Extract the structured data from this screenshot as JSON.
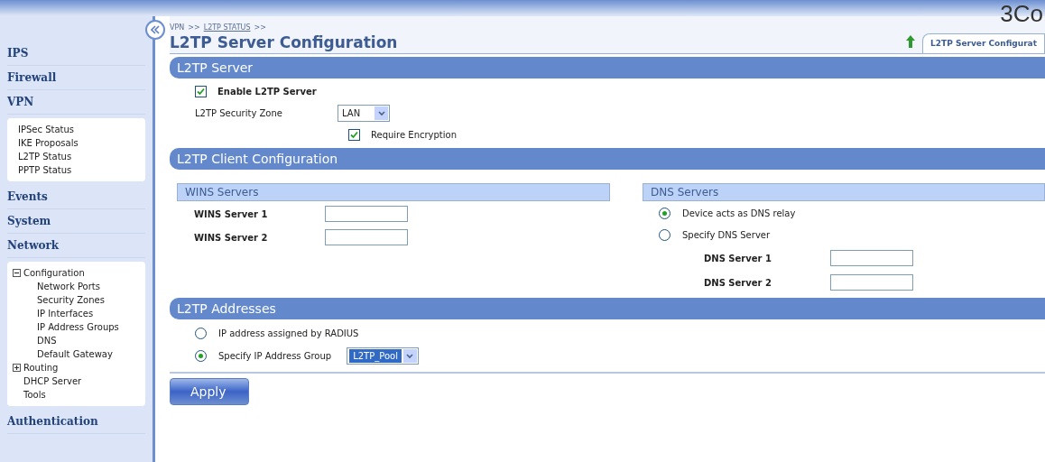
{
  "logo": "3Co",
  "sidebar": {
    "groups": [
      {
        "label": "IPS"
      },
      {
        "label": "Firewall"
      },
      {
        "label": "VPN",
        "items": [
          {
            "label": "IPSec Status"
          },
          {
            "label": "IKE Proposals"
          },
          {
            "label": "L2TP Status"
          },
          {
            "label": "PPTP Status"
          }
        ]
      },
      {
        "label": "Events"
      },
      {
        "label": "System"
      },
      {
        "label": "Network",
        "items": [
          {
            "label": "Configuration",
            "kind": "branch",
            "expanded": true,
            "children": [
              {
                "label": "Network Ports"
              },
              {
                "label": "Security Zones"
              },
              {
                "label": "IP Interfaces"
              },
              {
                "label": "IP Address Groups"
              },
              {
                "label": "DNS"
              },
              {
                "label": "Default Gateway"
              }
            ]
          },
          {
            "label": "Routing",
            "kind": "branch",
            "expanded": false
          },
          {
            "label": "DHCP Server"
          },
          {
            "label": "Tools"
          }
        ]
      },
      {
        "label": "Authentication"
      }
    ]
  },
  "breadcrumb": [
    {
      "label": "VPN",
      "link": false
    },
    {
      "label": ">>",
      "link": false
    },
    {
      "label": "L2TP STATUS",
      "link": true
    },
    {
      "label": ">>",
      "link": false
    }
  ],
  "title": "L2TP Server Configuration",
  "tab": {
    "label": "L2TP Server Configurat",
    "selected": true
  },
  "server": {
    "heading": "L2TP Server",
    "enable": {
      "label": "Enable L2TP Server",
      "checked": true
    },
    "zone": {
      "label": "L2TP Security Zone",
      "value": "LAN"
    },
    "encryption": {
      "label": "Require Encryption",
      "checked": true
    }
  },
  "client": {
    "heading": "L2TP Client Configuration",
    "wins": {
      "heading": "WINS Servers",
      "fields": [
        {
          "label": "WINS Server 1"
        },
        {
          "label": "WINS Server 2"
        }
      ]
    },
    "dns": {
      "heading": "DNS Servers",
      "options": [
        {
          "label": "Device acts as DNS relay",
          "selected": true
        },
        {
          "label": "Specify DNS Server",
          "selected": false
        }
      ],
      "fields": [
        {
          "label": "DNS Server 1"
        },
        {
          "label": "DNS Server 2"
        }
      ]
    }
  },
  "addresses": {
    "heading": "L2TP Addresses",
    "options": [
      {
        "label": "IP address assigned by RADIUS",
        "selected": false
      },
      {
        "label": "Specify IP Address Group",
        "selected": true,
        "select": "L2TP_Pool"
      }
    ]
  },
  "apply": "Apply"
}
